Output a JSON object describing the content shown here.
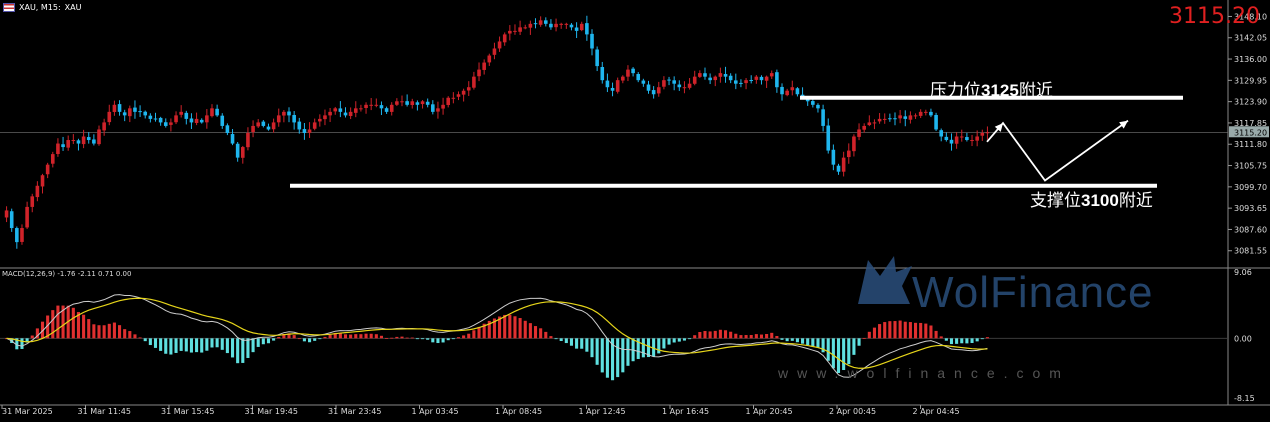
{
  "header": {
    "symbol": "XAU, M15:",
    "description": "XAU"
  },
  "big_price": "3115.20",
  "annotations": {
    "resistance": {
      "prefix": "压力位",
      "value": "3125",
      "suffix": "附近"
    },
    "support": {
      "prefix": "支撑位",
      "value": "3100",
      "suffix": "附近"
    }
  },
  "watermark": {
    "brand": "WolFinance",
    "url": "www.wolfinance.com"
  },
  "macd_header": "MACD(12,26,9) -1.76 -2.11 0.71 0.00",
  "colors": {
    "bull": "#d0232a",
    "bear": "#1fb6ee",
    "grid": "#333333",
    "macd_pos": "#e03030",
    "macd_neg": "#5fe0e0",
    "signal": "#e6d51a",
    "macd_line": "#cccccc"
  },
  "chart_data": [
    {
      "type": "candlestick",
      "symbol": "XAU",
      "timeframe": "M15",
      "current_price": 3115.2,
      "y_ticks": [
        "3148.10",
        "3142.05",
        "3136.00",
        "3129.95",
        "3123.90",
        "3117.85",
        "3111.80",
        "3105.75",
        "3099.70",
        "3093.65",
        "3087.60",
        "3081.55"
      ],
      "ylim": [
        3077.5,
        3150.5
      ],
      "x_ticks": [
        "31 Mar 2025",
        "31 Mar 11:45",
        "31 Mar 15:45",
        "31 Mar 19:45",
        "31 Mar 23:45",
        "1 Apr 03:45",
        "1 Apr 08:45",
        "1 Apr 12:45",
        "1 Apr 16:45",
        "1 Apr 20:45",
        "2 Apr 00:45",
        "2 Apr 04:45"
      ],
      "closes": [
        3093,
        3088,
        3084,
        3088,
        3094,
        3097,
        3100,
        3103,
        3106,
        3109,
        3112,
        3111,
        3113,
        3113,
        3112,
        3114,
        3113,
        3112,
        3116,
        3118,
        3121,
        3123,
        3121,
        3120,
        3122,
        3121,
        3121,
        3120,
        3119,
        3119,
        3118,
        3117,
        3118,
        3120,
        3121,
        3119,
        3118,
        3119,
        3118,
        3120,
        3122,
        3120,
        3117,
        3115,
        3112,
        3108,
        3111,
        3115,
        3117,
        3118,
        3117,
        3116,
        3118,
        3120,
        3121,
        3120,
        3118,
        3116,
        3115,
        3116,
        3118,
        3119,
        3120,
        3121,
        3122,
        3121,
        3120,
        3121,
        3122,
        3122,
        3123,
        3123,
        3123,
        3122,
        3121,
        3123,
        3124,
        3124,
        3123,
        3124,
        3123,
        3124,
        3123,
        3121,
        3122,
        3123,
        3125,
        3125,
        3126,
        3127,
        3128,
        3131,
        3133,
        3135,
        3137,
        3139,
        3141,
        3143,
        3144,
        3144,
        3145,
        3145,
        3146,
        3146,
        3147,
        3146,
        3145,
        3146,
        3146,
        3146,
        3145,
        3144,
        3146,
        3143,
        3139,
        3134,
        3130,
        3128,
        3127,
        3130,
        3131,
        3133,
        3132,
        3130,
        3129,
        3127,
        3126,
        3128,
        3130,
        3130,
        3129,
        3128,
        3128,
        3129,
        3131,
        3132,
        3131,
        3130,
        3131,
        3132,
        3131,
        3130,
        3129,
        3129,
        3130,
        3130,
        3131,
        3130,
        3131,
        3132,
        3128,
        3126,
        3127,
        3128,
        3126,
        3125,
        3124,
        3123,
        3122,
        3117,
        3110,
        3106,
        3104,
        3108,
        3110,
        3114,
        3116,
        3117,
        3118,
        3118,
        3119,
        3119,
        3119,
        3119,
        3120,
        3119,
        3120,
        3120,
        3121,
        3121,
        3120,
        3116,
        3114,
        3113,
        3112,
        3114,
        3114,
        3113,
        3113,
        3114,
        3115,
        3115.2
      ],
      "levels": [
        {
          "label": "压力位3125附近",
          "value": 3125
        },
        {
          "label": "支撑位3100附近",
          "value": 3100
        }
      ]
    },
    {
      "type": "macd",
      "params": [
        12,
        26,
        9
      ],
      "values": {
        "macd": -1.76,
        "signal": -2.11,
        "hist": 0.71
      },
      "y_ticks": [
        "9.06",
        "0.00",
        "-8.15"
      ],
      "ylim": [
        -8.15,
        9.06
      ]
    }
  ]
}
